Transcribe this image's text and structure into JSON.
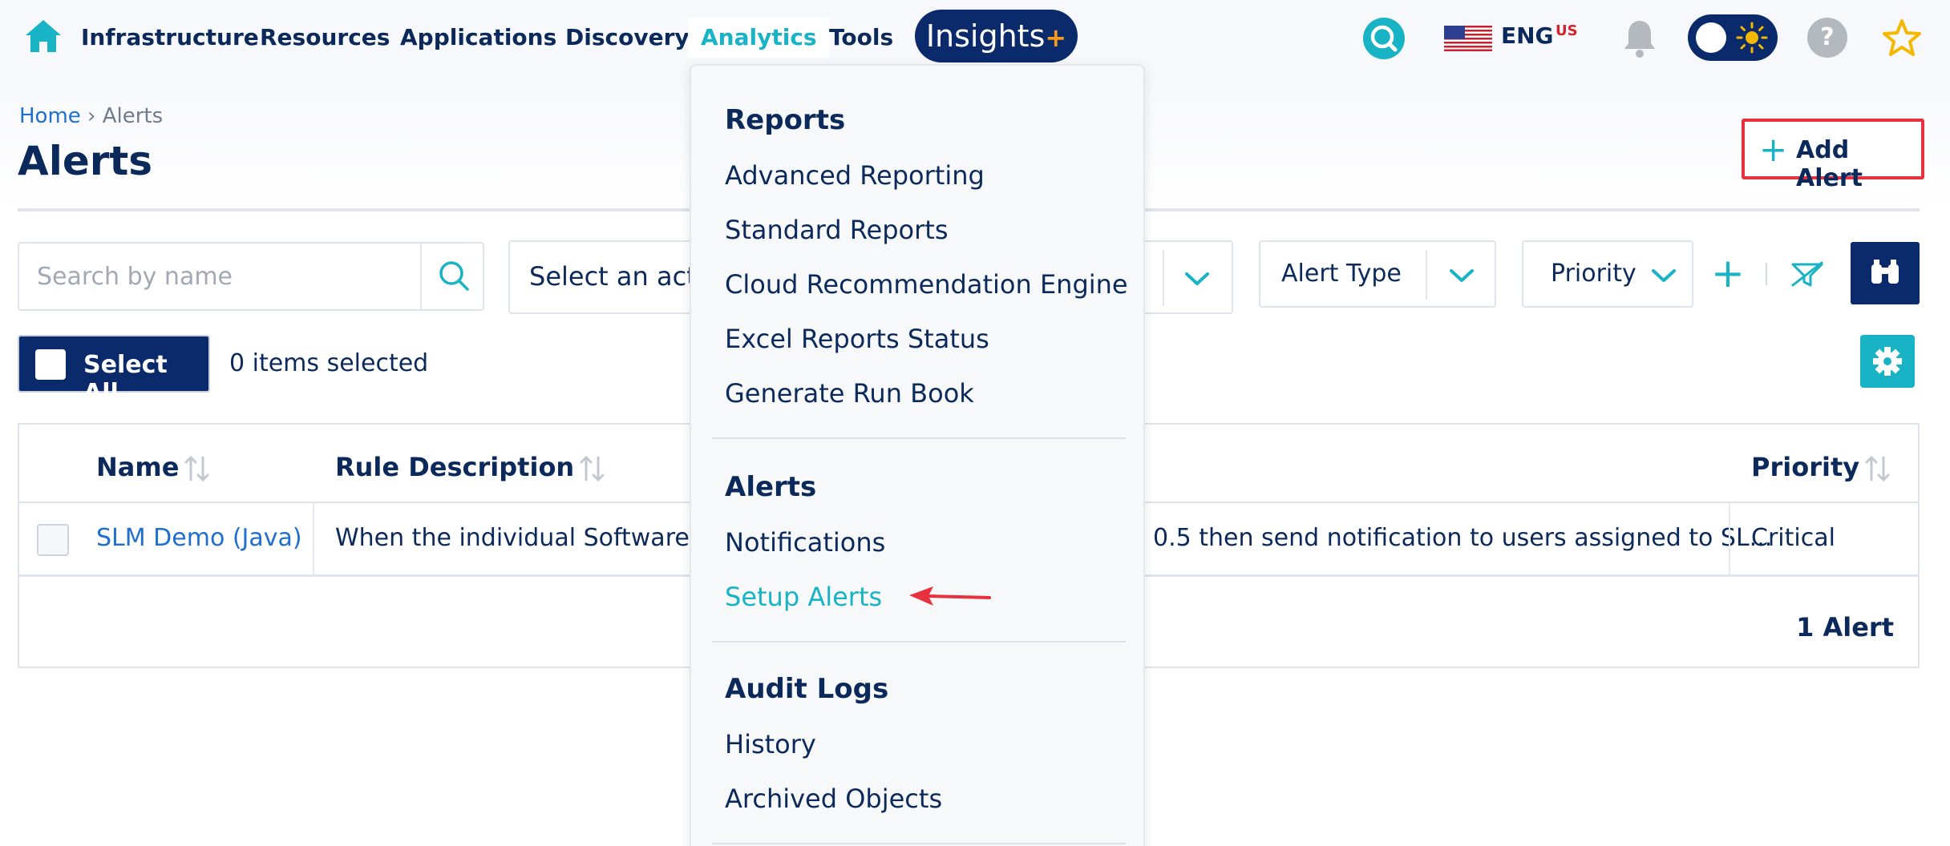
{
  "nav": {
    "items": [
      {
        "label": "Infrastructure"
      },
      {
        "label": "Resources"
      },
      {
        "label": "Applications"
      },
      {
        "label": "Discovery"
      },
      {
        "label": "Analytics",
        "active": true
      },
      {
        "label": "Tools"
      }
    ],
    "insights_label": "Insights",
    "insights_plus": "+",
    "lang": "ENG",
    "lang_region": "US",
    "help_symbol": "?"
  },
  "header": {
    "breadcrumb": {
      "home": "Home",
      "sep": "›",
      "current": "Alerts"
    },
    "title": "Alerts",
    "add_button": {
      "plus": "+",
      "label": "Add Alert"
    }
  },
  "filters": {
    "search_placeholder": "Search by name",
    "action_select": "Select an acti",
    "alert_type": "Alert Type",
    "priority": "Priority",
    "add_filter": "+"
  },
  "selection": {
    "select_all": "Select All",
    "items_selected": "0 items selected"
  },
  "table": {
    "columns": [
      "Name",
      "Rule Description",
      "Priority"
    ],
    "rows": [
      {
        "name": "SLM Demo (Java)",
        "rule_left": "When the individual Software Jav",
        "rule_right": "0.5 then send notification to users assigned to SL...",
        "priority": "Critical"
      }
    ],
    "count": "1 Alert"
  },
  "menu": {
    "sections": [
      {
        "heading": "Reports",
        "items": [
          "Advanced Reporting",
          "Standard Reports",
          "Cloud Recommendation Engine",
          "Excel Reports Status",
          "Generate Run Book"
        ]
      },
      {
        "heading": "Alerts",
        "items": [
          "Notifications",
          "Setup Alerts"
        ]
      },
      {
        "heading": "Audit Logs",
        "items": [
          "History",
          "Archived Objects"
        ]
      }
    ],
    "highlighted": "Setup Alerts"
  },
  "colors": {
    "navy": "#0b2a6b",
    "teal": "#19b3c6",
    "link_blue": "#1e6fd0",
    "red": "#e8313f"
  },
  "icons": [
    "home-icon",
    "search-icon",
    "us-flag-icon",
    "bell-icon",
    "sun-icon",
    "help-icon",
    "star-icon",
    "chevron-down-icon",
    "filter-clear-icon",
    "binoculars-icon",
    "gear-icon",
    "sort-icon",
    "red-arrow-icon"
  ]
}
